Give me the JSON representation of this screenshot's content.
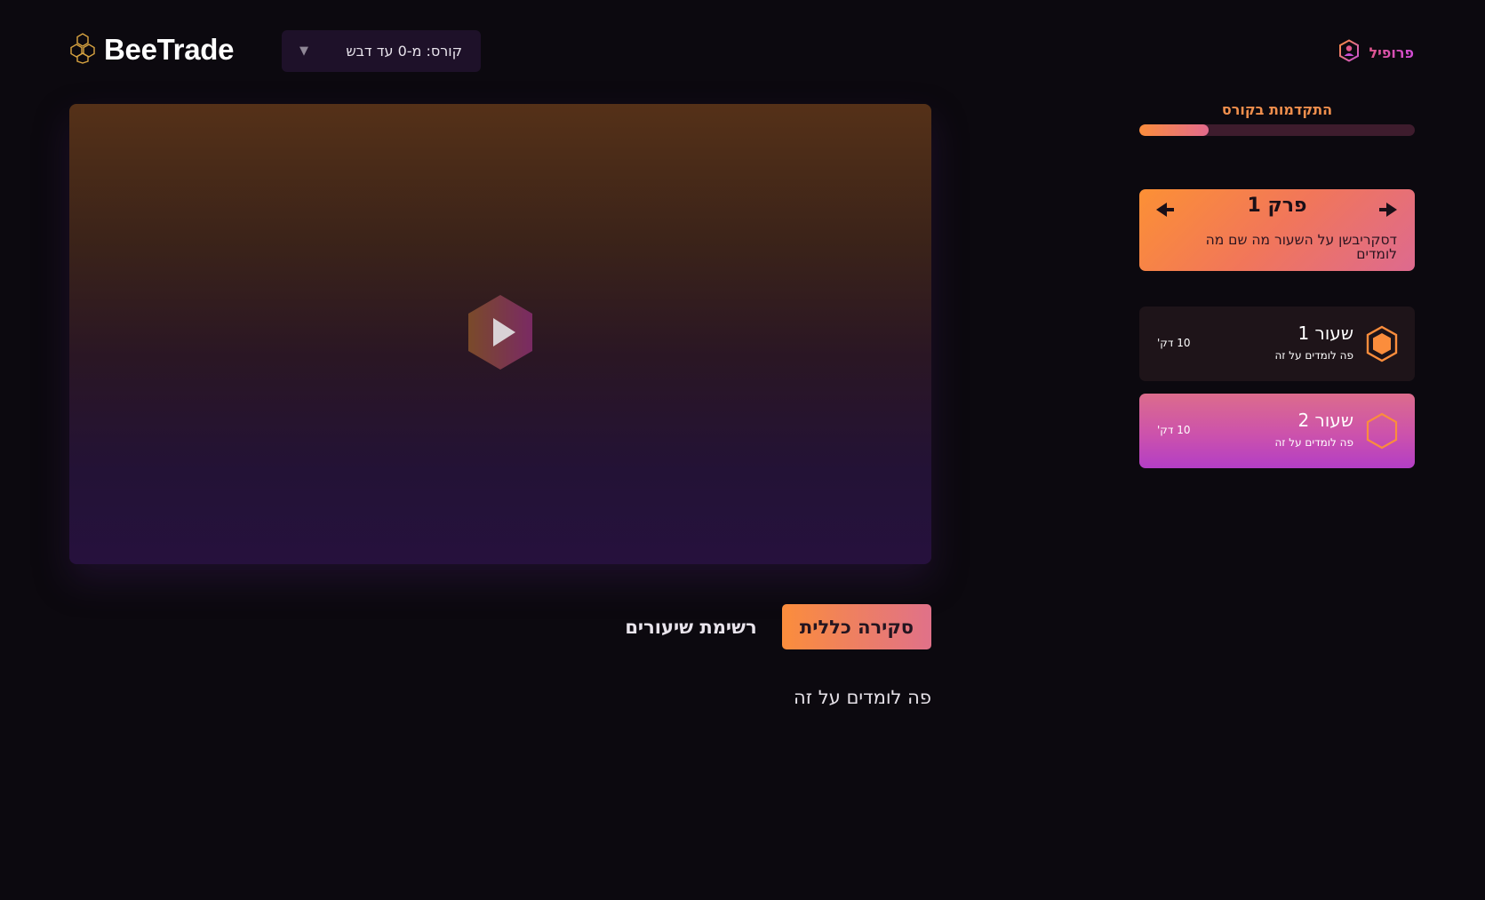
{
  "header": {
    "brand": "BeeTrade",
    "course_select": {
      "label": "קורס: מ-0 עד דבש",
      "caret": "▼"
    },
    "profile_label": "פרופיל"
  },
  "video": {
    "play_icon": "play-hexagon-icon"
  },
  "tabs": [
    {
      "label": "סקירה כללית",
      "active": true
    },
    {
      "label": "רשימת שיעורים",
      "active": false
    }
  ],
  "overview_text": "פה לומדים על זה",
  "progress": {
    "title": "התקדמות בקורס",
    "fraction": 0.25
  },
  "chapter": {
    "title": "פרק 1",
    "description": "דסקריבשן על השעור מה שם מה לומדים"
  },
  "lessons": [
    {
      "title": "שעור 1",
      "subtitle": "פה לומדים על זה",
      "duration": "10 דק'",
      "completed": true
    },
    {
      "title": "שעור 2",
      "subtitle": "פה לומדים על זה",
      "duration": "10 דק'",
      "completed": false
    }
  ],
  "colors": {
    "background": "#0c090f",
    "accent_orange": "#fb8d3c",
    "accent_pink": "#e07189",
    "accent_purple": "#b33ec5"
  }
}
